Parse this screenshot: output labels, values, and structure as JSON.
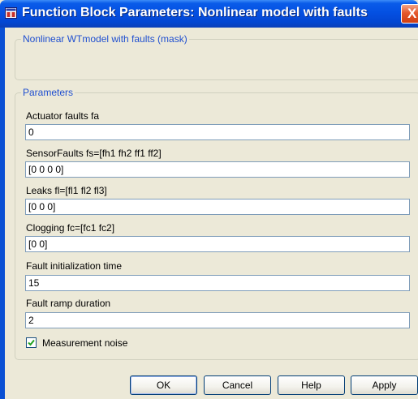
{
  "window": {
    "title": "Function Block Parameters: Nonlinear model with faults",
    "close_glyph": "X"
  },
  "mask": {
    "group_title": "Nonlinear WTmodel with faults (mask)"
  },
  "parameters": {
    "group_title": "Parameters",
    "fields": [
      {
        "label": "Actuator faults fa",
        "value": "0"
      },
      {
        "label": "SensorFaults fs=[fh1 fh2 ff1 ff2]",
        "value": "[0 0 0 0]"
      },
      {
        "label": "Leaks fl=[fl1 fl2 fl3]",
        "value": "[0 0 0]"
      },
      {
        "label": "Clogging fc=[fc1 fc2]",
        "value": "[0 0]"
      },
      {
        "label": "Fault initialization time",
        "value": "15"
      },
      {
        "label": "Fault ramp duration",
        "value": "2"
      }
    ],
    "checkbox": {
      "label": "Measurement noise",
      "checked": true
    }
  },
  "buttons": {
    "ok": "OK",
    "cancel": "Cancel",
    "help": "Help",
    "apply": "Apply"
  },
  "icons": {
    "app": "simulink-block-icon",
    "close": "close-icon",
    "check": "checkmark-icon"
  },
  "colors": {
    "titlebar": "#0450e2",
    "close_button": "#e5572c",
    "dialog_background": "#ece9d8",
    "group_title": "#1f4fd0",
    "checkmark": "#21a121"
  }
}
